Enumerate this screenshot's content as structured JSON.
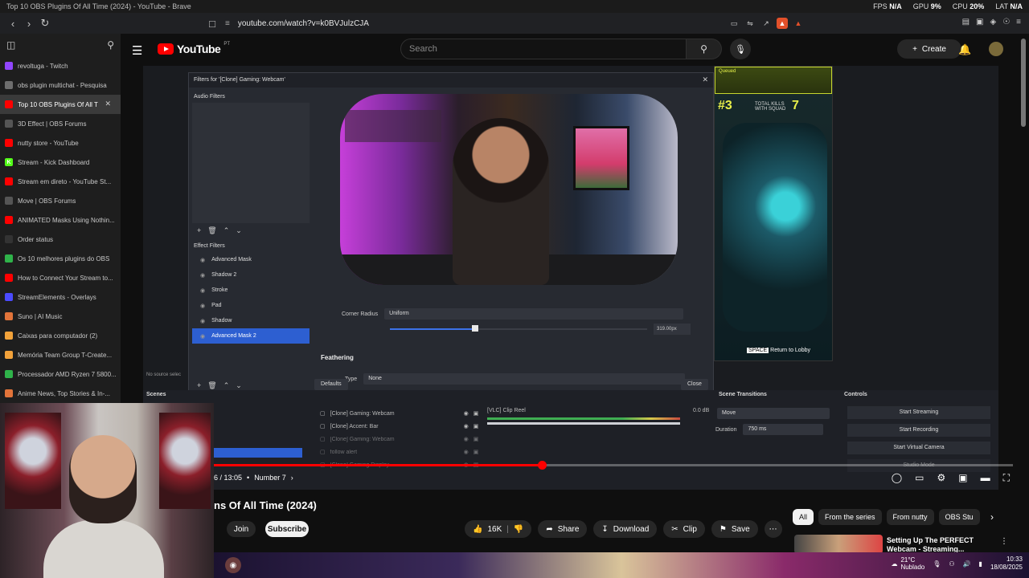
{
  "window": {
    "title": "Top 10 OBS Plugins Of All Time (2024) - YouTube - Brave"
  },
  "sys": {
    "fps_label": "FPS",
    "fps": "N/A",
    "gpu_label": "GPU",
    "gpu": "9%",
    "cpu_label": "CPU",
    "cpu": "20%",
    "lat_label": "LAT",
    "lat": "N/A"
  },
  "browser": {
    "url": "youtube.com/watch?v=k0BVJulzCJA"
  },
  "tabs": [
    {
      "label": "revoltuga - Twitch",
      "color": "#9146ff",
      "icon": ""
    },
    {
      "label": "obs plugin multichat - Pesquisa",
      "color": "#6e6e6e",
      "icon": ""
    },
    {
      "label": "Top 10 OBS Plugins Of All T",
      "color": "#ff0000",
      "icon": ""
    },
    {
      "label": "3D Effect | OBS Forums",
      "color": "#555",
      "icon": ""
    },
    {
      "label": "nutty store - YouTube",
      "color": "#ff0000",
      "icon": ""
    },
    {
      "label": "Stream - Kick Dashboard",
      "color": "#53fc18",
      "icon": "K"
    },
    {
      "label": "Stream em direto - YouTube St...",
      "color": "#ff0000",
      "icon": ""
    },
    {
      "label": "Move | OBS Forums",
      "color": "#555",
      "icon": ""
    },
    {
      "label": "ANIMATED Masks Using Nothin...",
      "color": "#ff0000",
      "icon": ""
    },
    {
      "label": "Order status",
      "color": "#333",
      "icon": ""
    },
    {
      "label": "Os 10 melhores plugins do OBS",
      "color": "#2fb34a",
      "icon": ""
    },
    {
      "label": "How to Connect Your Stream to...",
      "color": "#ff0000",
      "icon": ""
    },
    {
      "label": "StreamElements - Overlays",
      "color": "#4b4bff",
      "icon": ""
    },
    {
      "label": "Suno | AI Music",
      "color": "#e2743a",
      "icon": ""
    },
    {
      "label": "Caixas para computador (2)",
      "color": "#f2a23a",
      "icon": ""
    },
    {
      "label": "Memória Team Group T-Create...",
      "color": "#f2a23a",
      "icon": ""
    },
    {
      "label": "Processador AMD Ryzen 7 5800...",
      "color": "#2fb34a",
      "icon": ""
    },
    {
      "label": "Anime News, Top Stories & In-...",
      "color": "#e2743a",
      "icon": ""
    }
  ],
  "youtube": {
    "logo": "YouTube",
    "country": "PT",
    "search_placeholder": "Search",
    "create": "Create"
  },
  "obs": {
    "dialog_title": "Filters for '[Clone] Gaming: Webcam'",
    "audio_filters": "Audio Filters",
    "effect_filters": "Effect Filters",
    "filters": [
      "Advanced Mask",
      "Shadow 2",
      "Stroke",
      "Pad",
      "Shadow",
      "Advanced Mask 2"
    ],
    "selected_filter": "Advanced Mask 2",
    "corner_radius_label": "Corner Radius",
    "corner_radius_value": "Uniform",
    "px_value": "319.00px",
    "feathering": "Feathering",
    "type_label": "Type",
    "type_value": "None",
    "defaults": "Defaults",
    "close": "Close",
    "no_source": "No source selec",
    "scenes": "Scenes",
    "sources": [
      "[Clone] Gaming: Webcam",
      "[Clone] Accent: Bar",
      "[Clone] Gaming: Webcam",
      "follow alert",
      "[Clone] Gaming Display"
    ],
    "vlc": "[VLC] Clip Reel",
    "vlc_db": "0.0 dB",
    "scene_transitions": "Scene Transitions",
    "transition": "Move",
    "duration_label": "Duration",
    "duration": "750 ms",
    "controls": "Controls",
    "controls_buttons": [
      "Start Streaming",
      "Start Recording",
      "Start Virtual Camera",
      "Studio Mode"
    ],
    "game_queued": "Queued",
    "game_rank": "#3",
    "game_kills_label": "TOTAL KILLS WITH SQUAD",
    "game_kills": "7",
    "game_lobby": "Return to Lobby",
    "game_space": "SPACE"
  },
  "player": {
    "time": "6 / 13:05",
    "chapter": "Number 7",
    "progress": 0.41
  },
  "video": {
    "title": "ns Of All Time (2024)",
    "join": "Join",
    "subscribe": "Subscribe",
    "likes": "16K",
    "share": "Share",
    "download": "Download",
    "clip": "Clip",
    "save": "Save"
  },
  "chips": [
    "All",
    "From the series",
    "From nutty",
    "OBS Stu"
  ],
  "recommendation": {
    "title": "Setting Up The PERFECT Webcam - Streaming..."
  },
  "taskbar": {
    "temp": "21°C",
    "weather": "Nublado",
    "time": "10:33",
    "date": "18/08/2025"
  }
}
